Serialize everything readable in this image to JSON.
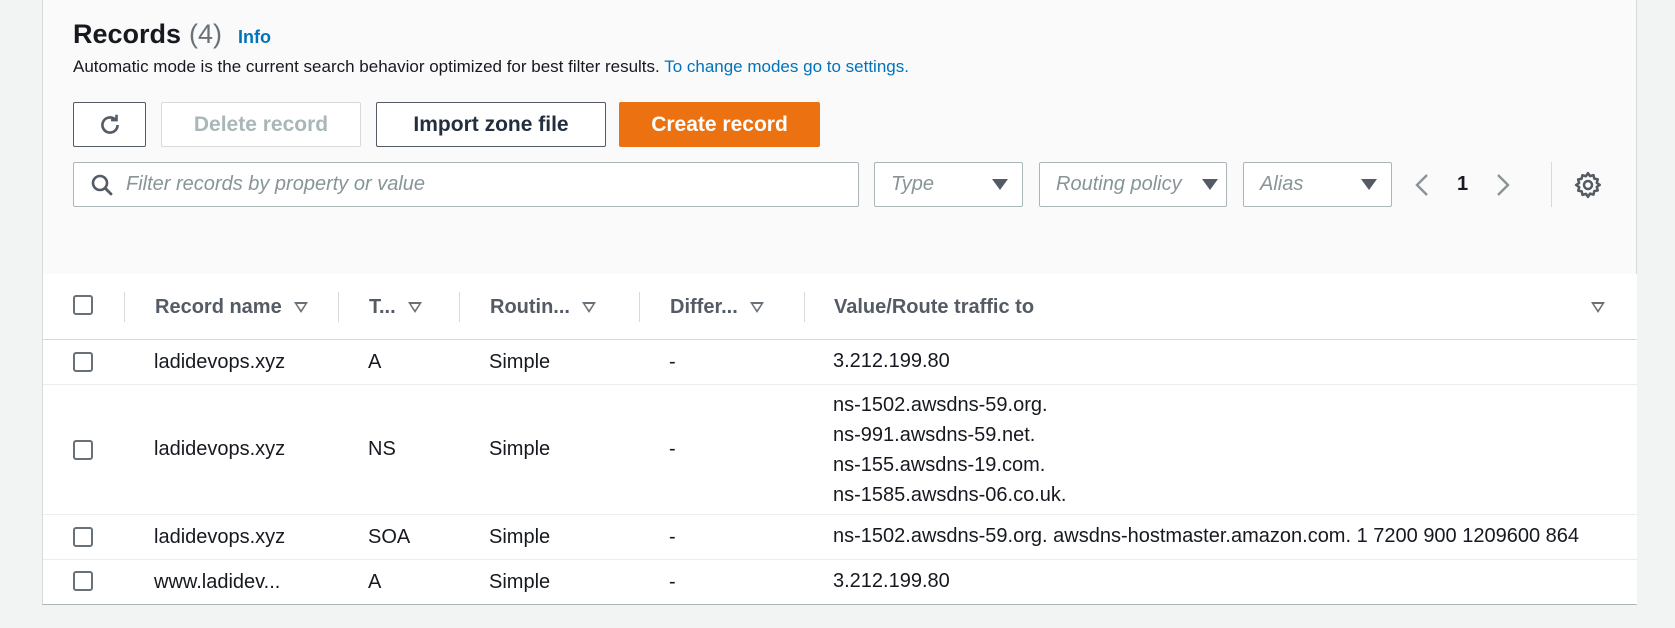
{
  "header": {
    "title": "Records",
    "count": "(4)",
    "info_link": "Info",
    "description": "Automatic mode is the current search behavior optimized for best filter results.",
    "settings_link": "To change modes go to settings."
  },
  "toolbar": {
    "delete_label": "Delete record",
    "import_label": "Import zone file",
    "create_label": "Create record"
  },
  "filters": {
    "search_placeholder": "Filter records by property or value",
    "type_placeholder": "Type",
    "routing_placeholder": "Routing policy",
    "alias_placeholder": "Alias"
  },
  "pagination": {
    "current_page": "1"
  },
  "table": {
    "columns": [
      "Record name",
      "T...",
      "Routin...",
      "Differ...",
      "Value/Route traffic to"
    ],
    "rows": [
      {
        "name": "ladidevops.xyz",
        "type": "A",
        "routing": "Simple",
        "differ": "-",
        "value": [
          "3.212.199.80"
        ]
      },
      {
        "name": "ladidevops.xyz",
        "type": "NS",
        "routing": "Simple",
        "differ": "-",
        "value": [
          "ns-1502.awsdns-59.org.",
          "ns-991.awsdns-59.net.",
          "ns-155.awsdns-19.com.",
          "ns-1585.awsdns-06.co.uk."
        ]
      },
      {
        "name": "ladidevops.xyz",
        "type": "SOA",
        "routing": "Simple",
        "differ": "-",
        "value": [
          "ns-1502.awsdns-59.org. awsdns-hostmaster.amazon.com. 1 7200 900 1209600 864"
        ]
      },
      {
        "name": "www.ladidev...",
        "type": "A",
        "routing": "Simple",
        "differ": "-",
        "value": [
          "3.212.199.80"
        ]
      }
    ]
  },
  "colors": {
    "accent": "#ec7211",
    "link": "#0073bb"
  }
}
